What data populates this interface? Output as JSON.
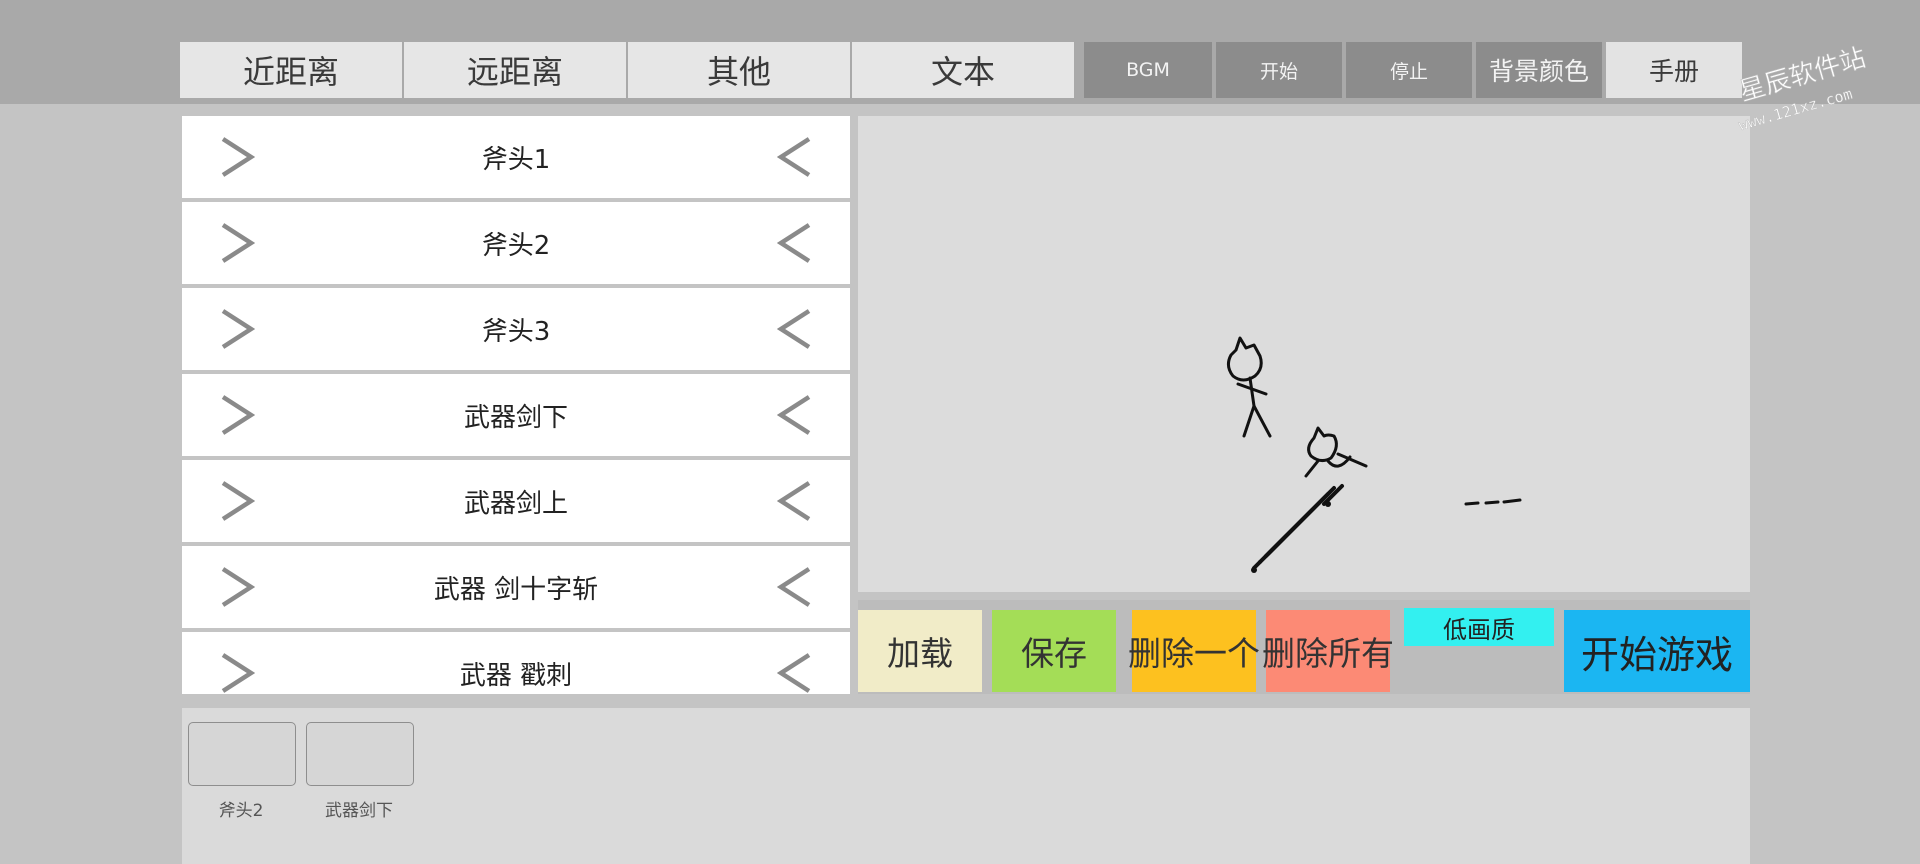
{
  "top_tabs": [
    "近距离",
    "远距离",
    "其他",
    "文本"
  ],
  "top_buttons": {
    "bgm": "BGM",
    "start": "开始",
    "stop": "停止",
    "bg_color": "背景颜色",
    "manual": "手册"
  },
  "action_list": [
    "斧头1",
    "斧头2",
    "斧头3",
    "武器剑下",
    "武器剑上",
    "武器 剑十字斩",
    "武器 戳刺"
  ],
  "controls": {
    "load": "加载",
    "save": "保存",
    "delete_one": "删除一个",
    "delete_all": "删除所有",
    "low_quality": "低画质",
    "start_game": "开始游戏"
  },
  "timeline": [
    "斧头2",
    "武器剑下"
  ],
  "watermark": {
    "title": "星辰软件站",
    "url": "www.121xz.com"
  },
  "colors": {
    "load": "#f1ecc8",
    "save": "#a4dd57",
    "delete_one": "#fdc11f",
    "delete_all": "#fc8a75",
    "low_quality": "#33f0f0",
    "start_game": "#1bb6f2"
  },
  "icons": {
    "arrow_left_side": "chevron-right-icon",
    "arrow_right_side": "chevron-left-icon"
  }
}
